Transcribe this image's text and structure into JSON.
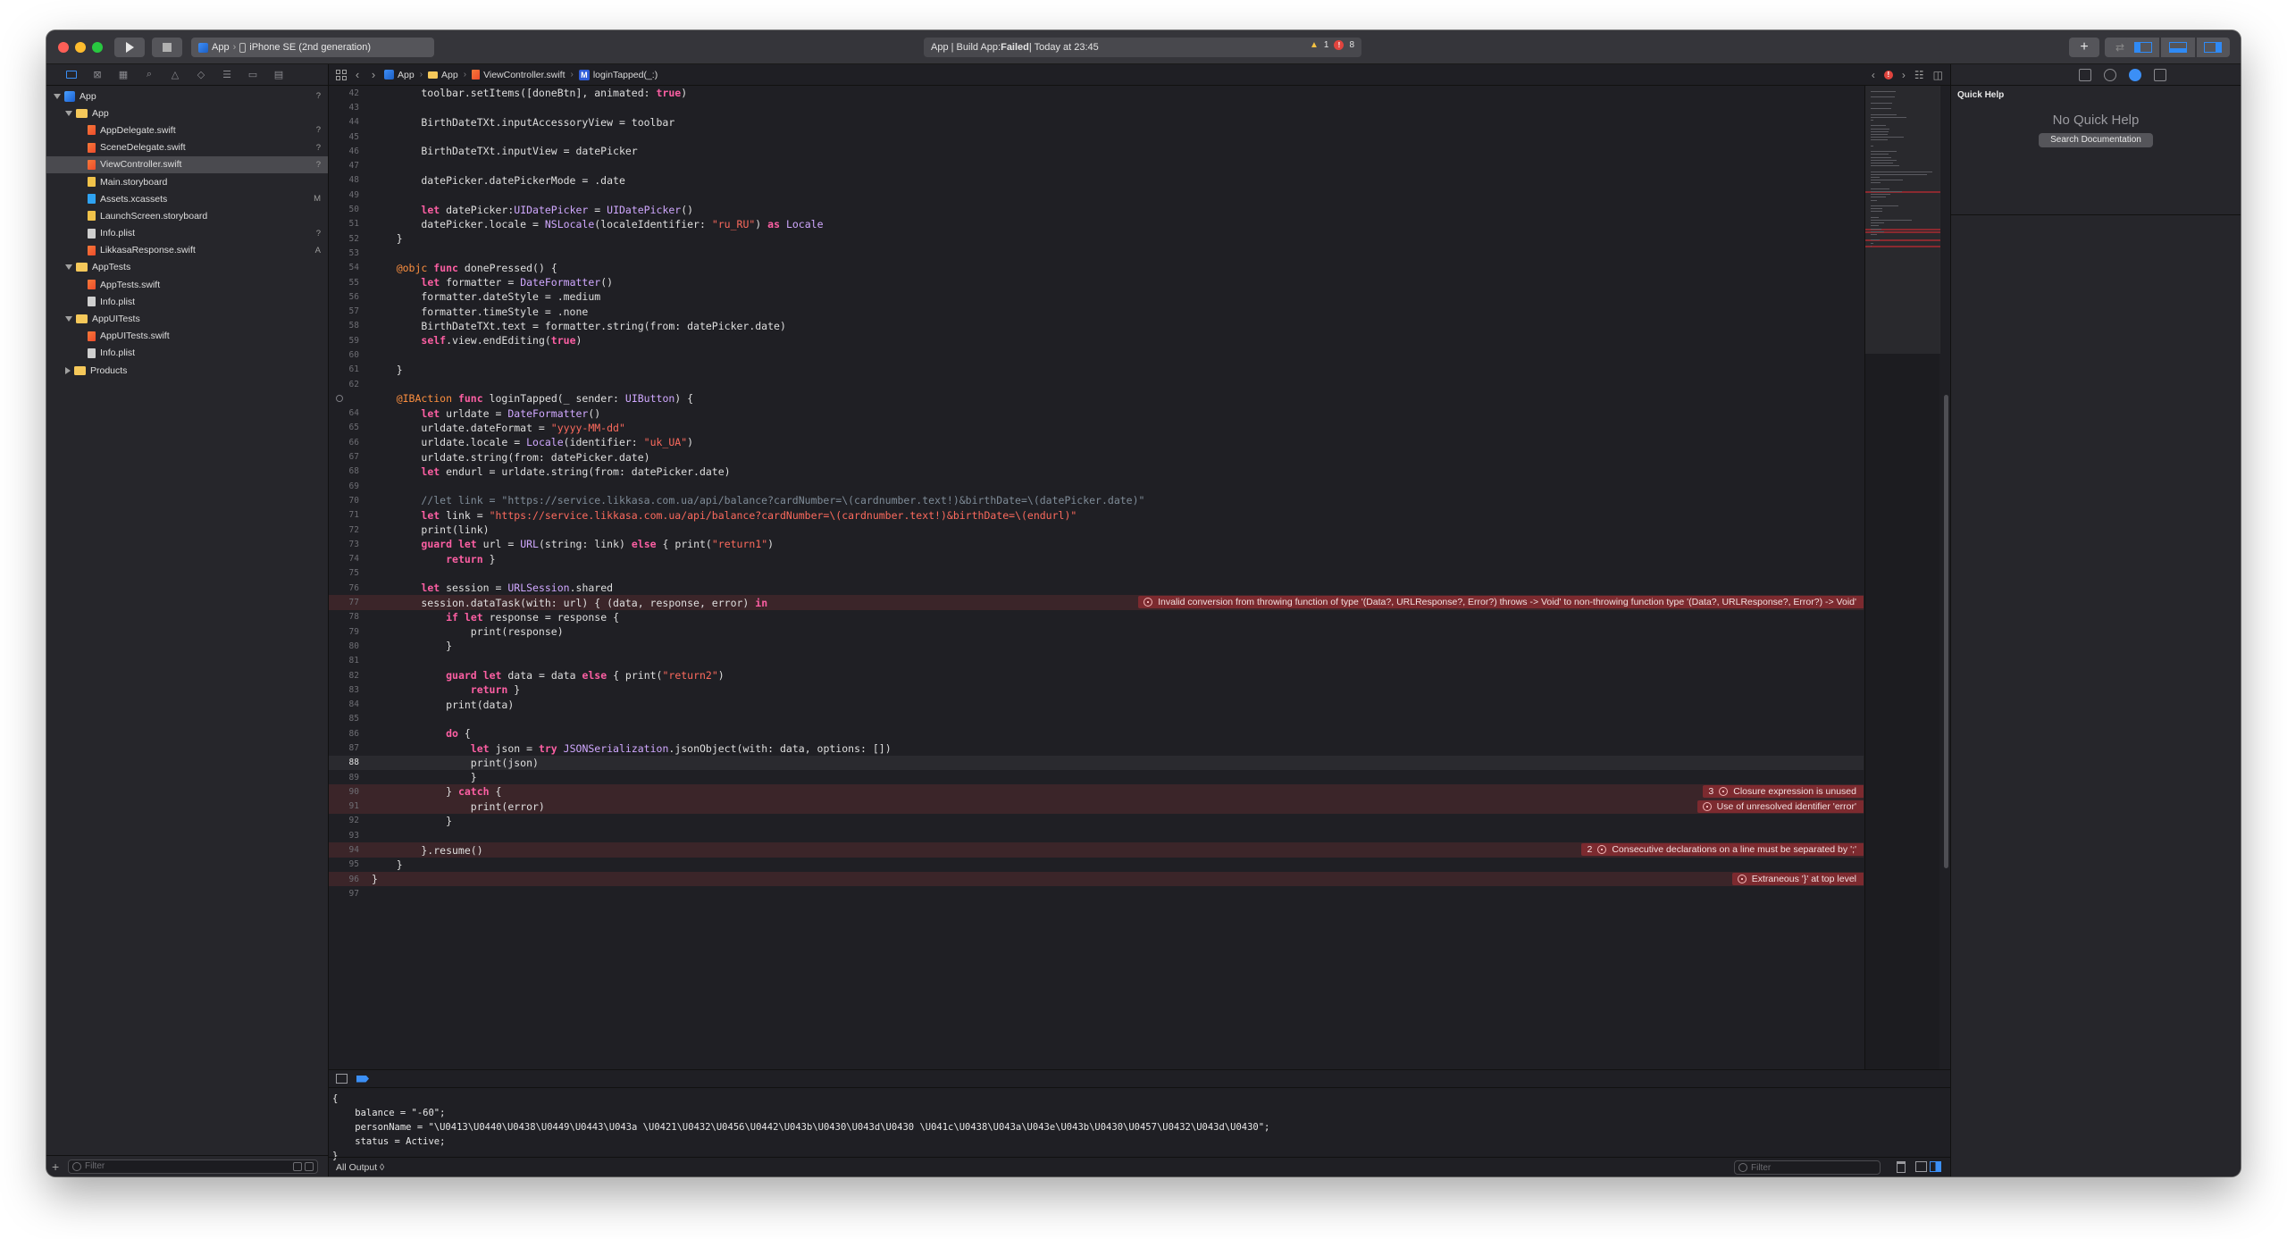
{
  "toolbar": {
    "scheme_app": "App",
    "scheme_device": "iPhone SE (2nd generation)",
    "activity_prefix": "App | Build App: ",
    "activity_status": "Failed",
    "activity_time": " | Today at 23:45",
    "warning_count": "1",
    "error_count": "8",
    "library_glyph": "+",
    "review_glyph": "⇄"
  },
  "navigator": {
    "items": [
      {
        "label": "App",
        "kind": "project",
        "indent": 0,
        "disclosure": "open",
        "badge": "?"
      },
      {
        "label": "App",
        "kind": "folder",
        "indent": 1,
        "disclosure": "open",
        "badge": ""
      },
      {
        "label": "AppDelegate.swift",
        "kind": "swift",
        "indent": 2,
        "disclosure": "",
        "badge": "?"
      },
      {
        "label": "SceneDelegate.swift",
        "kind": "swift",
        "indent": 2,
        "disclosure": "",
        "badge": "?"
      },
      {
        "label": "ViewController.swift",
        "kind": "swift",
        "indent": 2,
        "disclosure": "",
        "badge": "?",
        "selected": true
      },
      {
        "label": "Main.storyboard",
        "kind": "storyboard",
        "indent": 2,
        "disclosure": "",
        "badge": ""
      },
      {
        "label": "Assets.xcassets",
        "kind": "xcassets",
        "indent": 2,
        "disclosure": "",
        "badge": "M"
      },
      {
        "label": "LaunchScreen.storyboard",
        "kind": "storyboard",
        "indent": 2,
        "disclosure": "",
        "badge": ""
      },
      {
        "label": "Info.plist",
        "kind": "plist",
        "indent": 2,
        "disclosure": "",
        "badge": "?"
      },
      {
        "label": "LikkasaResponse.swift",
        "kind": "swift",
        "indent": 2,
        "disclosure": "",
        "badge": "A"
      },
      {
        "label": "AppTests",
        "kind": "folder",
        "indent": 1,
        "disclosure": "open",
        "badge": ""
      },
      {
        "label": "AppTests.swift",
        "kind": "swift",
        "indent": 2,
        "disclosure": "",
        "badge": ""
      },
      {
        "label": "Info.plist",
        "kind": "plist",
        "indent": 2,
        "disclosure": "",
        "badge": ""
      },
      {
        "label": "AppUITests",
        "kind": "folder",
        "indent": 1,
        "disclosure": "open",
        "badge": ""
      },
      {
        "label": "AppUITests.swift",
        "kind": "swift",
        "indent": 2,
        "disclosure": "",
        "badge": ""
      },
      {
        "label": "Info.plist",
        "kind": "plist",
        "indent": 2,
        "disclosure": "",
        "badge": ""
      },
      {
        "label": "Products",
        "kind": "folder",
        "indent": 1,
        "disclosure": "collapsed",
        "badge": ""
      }
    ],
    "filter_placeholder": "Filter"
  },
  "jumpbar": {
    "crumbs": [
      "App",
      "App",
      "ViewController.swift",
      "loginTapped(_:)"
    ],
    "method_badge": "M"
  },
  "editor": {
    "lines": [
      {
        "n": "42",
        "t": "        toolbar.setItems([doneBtn], animated: true)"
      },
      {
        "n": "43",
        "t": ""
      },
      {
        "n": "44",
        "t": "        BirthDateTXt.inputAccessoryView = toolbar"
      },
      {
        "n": "45",
        "t": ""
      },
      {
        "n": "46",
        "t": "        BirthDateTXt.inputView = datePicker"
      },
      {
        "n": "47",
        "t": ""
      },
      {
        "n": "48",
        "t": "        datePicker.datePickerMode = .date"
      },
      {
        "n": "49",
        "t": ""
      },
      {
        "n": "50",
        "t": "        let datePicker:UIDatePicker = UIDatePicker()"
      },
      {
        "n": "51",
        "t": "        datePicker.locale = NSLocale(localeIdentifier: \"ru_RU\") as Locale"
      },
      {
        "n": "52",
        "t": "    }"
      },
      {
        "n": "53",
        "t": ""
      },
      {
        "n": "54",
        "t": "    @objc func donePressed() {"
      },
      {
        "n": "55",
        "t": "        let formatter = DateFormatter()"
      },
      {
        "n": "56",
        "t": "        formatter.dateStyle = .medium"
      },
      {
        "n": "57",
        "t": "        formatter.timeStyle = .none"
      },
      {
        "n": "58",
        "t": "        BirthDateTXt.text = formatter.string(from: datePicker.date)"
      },
      {
        "n": "59",
        "t": "        self.view.endEditing(true)"
      },
      {
        "n": "60",
        "t": ""
      },
      {
        "n": "61",
        "t": "    }"
      },
      {
        "n": "62",
        "t": ""
      },
      {
        "n": "",
        "t": "    @IBAction func loginTapped(_ sender: UIButton) {",
        "bp": true
      },
      {
        "n": "64",
        "t": "        let urldate = DateFormatter()"
      },
      {
        "n": "65",
        "t": "        urldate.dateFormat = \"yyyy-MM-dd\""
      },
      {
        "n": "66",
        "t": "        urldate.locale = Locale(identifier: \"uk_UA\")"
      },
      {
        "n": "67",
        "t": "        urldate.string(from: datePicker.date)"
      },
      {
        "n": "68",
        "t": "        let endurl = urldate.string(from: datePicker.date)"
      },
      {
        "n": "69",
        "t": ""
      },
      {
        "n": "70",
        "t": "        //let link = \"https://service.likkasa.com.ua/api/balance?cardNumber=\\(cardnumber.text!)&birthDate=\\(datePicker.date)\""
      },
      {
        "n": "71",
        "t": "        let link = \"https://service.likkasa.com.ua/api/balance?cardNumber=\\(cardnumber.text!)&birthDate=\\(endurl)\""
      },
      {
        "n": "72",
        "t": "        print(link)"
      },
      {
        "n": "73",
        "t": "        guard let url = URL(string: link) else { print(\"return1\")"
      },
      {
        "n": "74",
        "t": "            return }"
      },
      {
        "n": "75",
        "t": ""
      },
      {
        "n": "76",
        "t": "        let session = URLSession.shared"
      },
      {
        "n": "77",
        "t": "        session.dataTask(with: url) { (data, response, error) in",
        "err": true
      },
      {
        "n": "78",
        "t": "            if let response = response {"
      },
      {
        "n": "79",
        "t": "                print(response)"
      },
      {
        "n": "80",
        "t": "            }"
      },
      {
        "n": "81",
        "t": ""
      },
      {
        "n": "82",
        "t": "            guard let data = data else { print(\"return2\")"
      },
      {
        "n": "83",
        "t": "                return }"
      },
      {
        "n": "84",
        "t": "            print(data)"
      },
      {
        "n": "85",
        "t": ""
      },
      {
        "n": "86",
        "t": "            do {"
      },
      {
        "n": "87",
        "t": "                let json = try JSONSerialization.jsonObject(with: data, options: [])"
      },
      {
        "n": "88",
        "t": "                print(json)",
        "cur": true
      },
      {
        "n": "89",
        "t": "                }"
      },
      {
        "n": "90",
        "t": "            } catch {",
        "err": true
      },
      {
        "n": "91",
        "t": "                print(error)",
        "err": true
      },
      {
        "n": "92",
        "t": "            }"
      },
      {
        "n": "93",
        "t": ""
      },
      {
        "n": "94",
        "t": "        }.resume()",
        "err": true
      },
      {
        "n": "95",
        "t": "    }"
      },
      {
        "n": "96",
        "t": "}",
        "err": true
      },
      {
        "n": "97",
        "t": ""
      }
    ],
    "issues": [
      {
        "line": "77",
        "count": "",
        "text": "Invalid conversion from throwing function of type '(Data?, URLResponse?, Error?) throws -> Void' to non-throwing function type '(Data?, URLResponse?, Error?) -> Void'"
      },
      {
        "line": "90",
        "count": "3",
        "text": "Closure expression is unused"
      },
      {
        "line": "91",
        "count": "",
        "text": "Use of unresolved identifier 'error'"
      },
      {
        "line": "94",
        "count": "2",
        "text": "Consecutive declarations on a line must be separated by ';'"
      },
      {
        "line": "96",
        "count": "",
        "text": "Extraneous '}' at top level"
      }
    ]
  },
  "debug": {
    "console_lines": [
      "{",
      "    balance = \"-60\";",
      "    personName = \"\\U0413\\U0440\\U0438\\U0449\\U0443\\U043a \\U0421\\U0432\\U0456\\U0442\\U043b\\U0430\\U043d\\U0430 \\U041c\\U0438\\U043a\\U043e\\U043b\\U0430\\U0457\\U0432\\U043d\\U0430\";",
      "    status = Active;",
      "}"
    ],
    "output_selector": "All Output ◊",
    "filter_placeholder": "Filter"
  },
  "inspector": {
    "title": "Quick Help",
    "empty_message": "No Quick Help",
    "search_button": "Search Documentation"
  }
}
